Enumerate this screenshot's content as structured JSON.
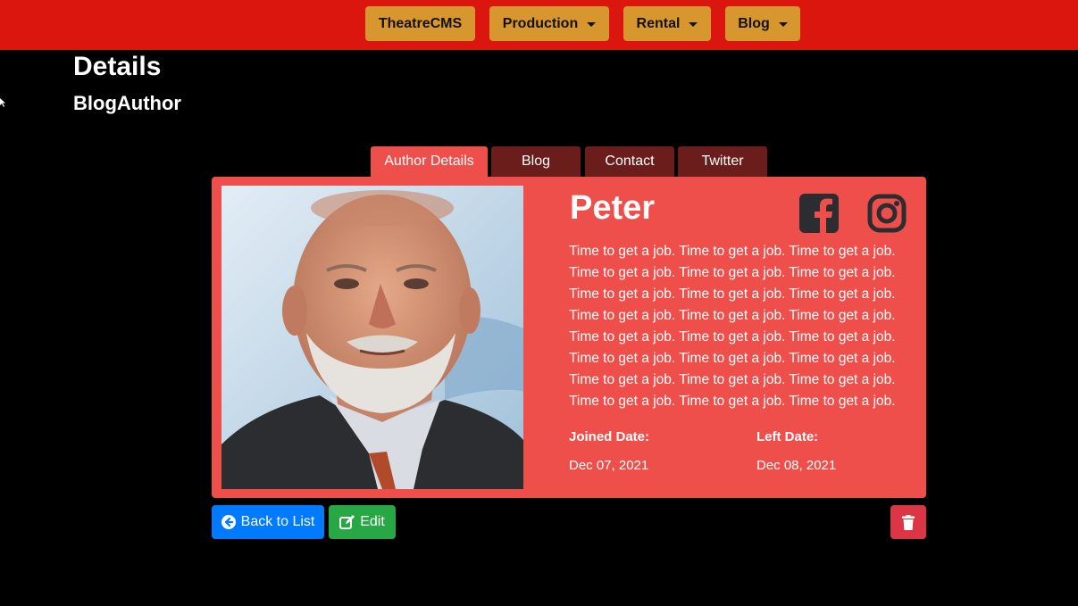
{
  "navbar": {
    "brand": "TheatreCMS",
    "menus": [
      "Production",
      "Rental",
      "Blog"
    ]
  },
  "page": {
    "title": "Details",
    "subtitle": "BlogAuthor"
  },
  "tabs": [
    {
      "label": "Author Details",
      "active": true
    },
    {
      "label": "Blog",
      "active": false
    },
    {
      "label": "Contact",
      "active": false
    },
    {
      "label": "Twitter",
      "active": false
    }
  ],
  "author": {
    "name": "Peter",
    "bio": "Time to get a job. Time to get a job. Time to get a job. Time to get a job. Time to get a job. Time to get a job. Time to get a job. Time to get a job. Time to get a job. Time to get a job. Time to get a job. Time to get a job. Time to get a job. Time to get a job. Time to get a job. Time to get a job. Time to get a job. Time to get a job. Time to get a job. Time to get a job. Time to get a job. Time to get a job. Time to get a job. Time to get a job.",
    "joined_label": "Joined Date:",
    "joined_value": "Dec 07, 2021",
    "left_label": "Left Date:",
    "left_value": "Dec 08, 2021",
    "social_icons": [
      "facebook-icon",
      "instagram-icon"
    ]
  },
  "actions": {
    "back_label": "Back to List",
    "edit_label": "Edit",
    "delete_icon": "trash-icon"
  },
  "colors": {
    "navbar": "#da160f",
    "nav_button": "#d8962e",
    "card": "#ef4f4a",
    "tab_inactive": "#6b1d1b",
    "back_button": "#007bff",
    "edit_button": "#28a745",
    "delete_button": "#dc3545"
  }
}
